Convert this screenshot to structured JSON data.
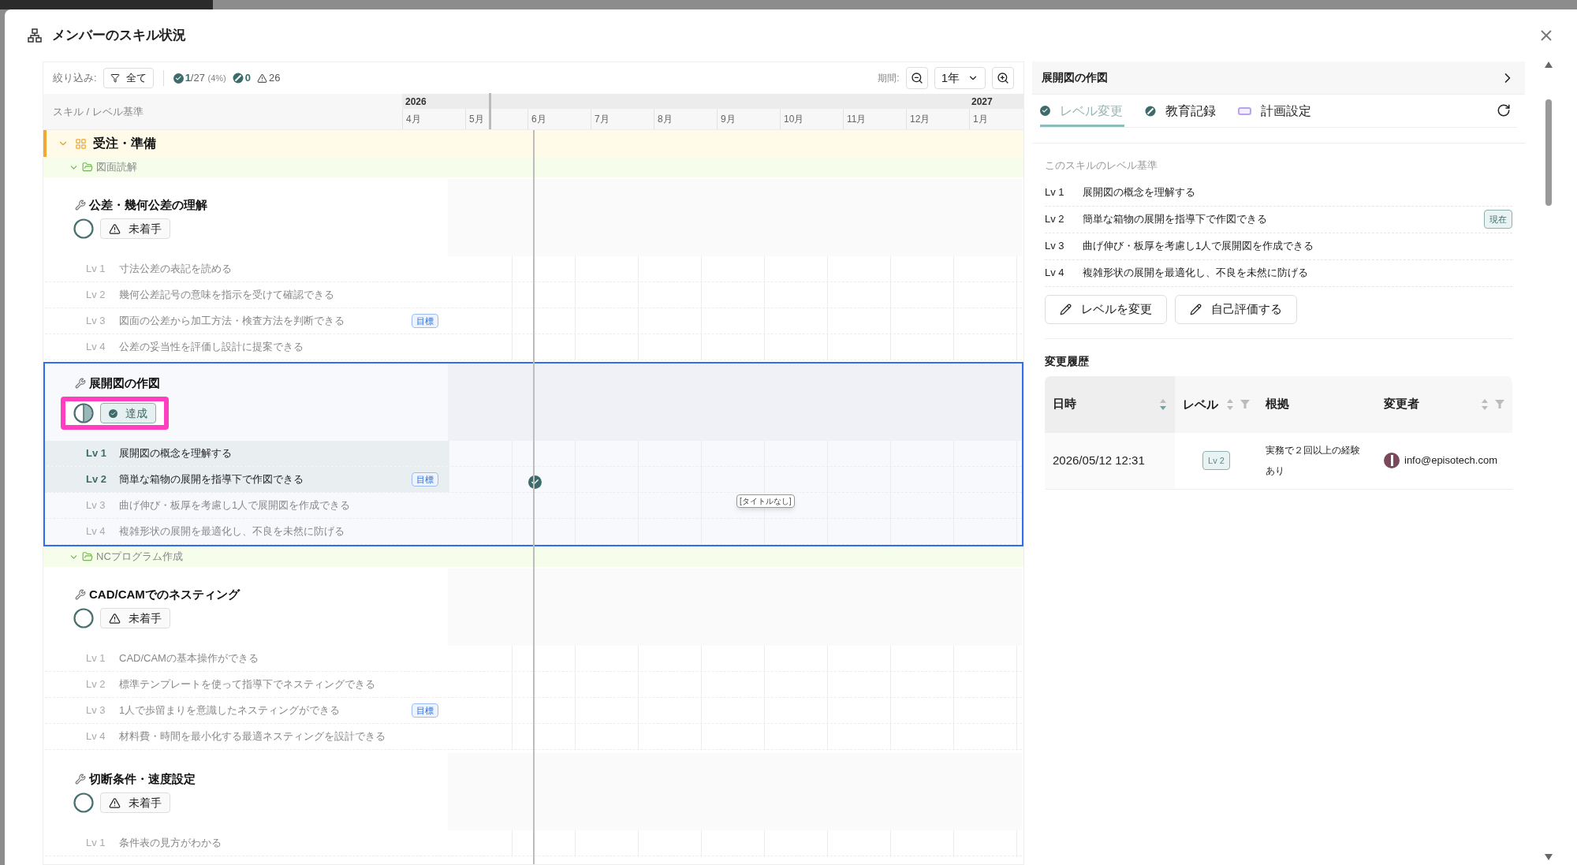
{
  "dialog": {
    "title": "メンバーのスキル状況"
  },
  "filter_bar": {
    "label": "絞り込み:",
    "filter_button": "全て",
    "achieved": "1",
    "achieved_total": "/27",
    "achieved_pct": "(4%)",
    "in_progress": "0",
    "not_started": "26",
    "period_label": "期間:",
    "period_value": "1年"
  },
  "timeline_header": {
    "column_label": "スキル / レベル基準",
    "years": [
      "2026",
      "2027"
    ],
    "months": [
      "4月",
      "5月",
      "6月",
      "7月",
      "8月",
      "9月",
      "10月",
      "11月",
      "12月",
      "1月"
    ]
  },
  "groups": [
    {
      "name": "受注・準備",
      "expanded": true,
      "categories": [
        {
          "name": "図面読解",
          "expanded": true,
          "skills": [
            {
              "name": "公差・幾何公差の理解",
              "kind": "not_started",
              "status_label": "未着手",
              "selected": false,
              "highlighted": false,
              "levels": [
                {
                  "label": "Lv 1",
                  "text": "寸法公差の表記を読める",
                  "achieved": false,
                  "marker": false
                },
                {
                  "label": "Lv 2",
                  "text": "幾何公差記号の意味を指示を受けて確認できる",
                  "achieved": false,
                  "marker": false
                },
                {
                  "label": "Lv 3",
                  "text": "図面の公差から加工方法・検査方法を判断できる",
                  "badge": "目標",
                  "achieved": false,
                  "marker": false
                },
                {
                  "label": "Lv 4",
                  "text": "公差の妥当性を評価し設計に提案できる",
                  "achieved": false,
                  "marker": false
                }
              ]
            },
            {
              "name": "展開図の作図",
              "kind": "achieved",
              "status_label": "達成",
              "selected": true,
              "highlighted": true,
              "levels": [
                {
                  "label": "Lv 1",
                  "text": "展開図の概念を理解する",
                  "achieved": true,
                  "marker": false
                },
                {
                  "label": "Lv 2",
                  "text": "簡単な箱物の展開を指導下で作図できる",
                  "badge": "目標",
                  "achieved": true,
                  "marker": true
                },
                {
                  "label": "Lv 3",
                  "text": "曲げ伸び・板厚を考慮し1人で展開図を作成できる",
                  "achieved": false,
                  "marker": false,
                  "tooltip": "[タイトルなし]"
                },
                {
                  "label": "Lv 4",
                  "text": "複雑形状の展開を最適化し、不良を未然に防げる",
                  "achieved": false,
                  "marker": false
                }
              ]
            }
          ]
        },
        {
          "name": "NCプログラム作成",
          "expanded": true,
          "skills": [
            {
              "name": "CAD/CAMでのネスティング",
              "kind": "not_started",
              "status_label": "未着手",
              "selected": false,
              "highlighted": false,
              "levels": [
                {
                  "label": "Lv 1",
                  "text": "CAD/CAMの基本操作ができる",
                  "achieved": false,
                  "marker": false
                },
                {
                  "label": "Lv 2",
                  "text": "標準テンプレートを使って指導下でネスティングできる",
                  "achieved": false,
                  "marker": false
                },
                {
                  "label": "Lv 3",
                  "text": "1人で歩留まりを意識したネスティングができる",
                  "badge": "目標",
                  "achieved": false,
                  "marker": false
                },
                {
                  "label": "Lv 4",
                  "text": "材料費・時間を最小化する最適ネスティングを設計できる",
                  "achieved": false,
                  "marker": false
                }
              ]
            },
            {
              "name": "切断条件・速度設定",
              "kind": "not_started",
              "status_label": "未着手",
              "selected": false,
              "highlighted": false,
              "levels": [
                {
                  "label": "Lv 1",
                  "text": "条件表の見方がわかる",
                  "achieved": false,
                  "marker": false
                }
              ]
            }
          ]
        }
      ]
    }
  ],
  "detail_panel": {
    "title": "展開図の作図",
    "tabs": [
      {
        "label": "レベル変更",
        "kind": "check",
        "selected": true
      },
      {
        "label": "教育記録",
        "kind": "slash",
        "selected": false
      },
      {
        "label": "計画設定",
        "kind": "plan",
        "selected": false
      }
    ],
    "criteria_title": "このスキルのレベル基準",
    "criteria": [
      {
        "label": "Lv 1",
        "text": "展開図の概念を理解する"
      },
      {
        "label": "Lv 2",
        "text": "簡単な箱物の展開を指導下で作図できる",
        "badge": "現在"
      },
      {
        "label": "Lv 3",
        "text": "曲げ伸び・板厚を考慮し1人で展開図を作成できる"
      },
      {
        "label": "Lv 4",
        "text": "複雑形状の展開を最適化し、不良を未然に防げる"
      }
    ],
    "buttons": [
      "レベルを変更",
      "自己評価する"
    ],
    "history_title": "変更履歴",
    "history_columns": [
      {
        "label": "日時",
        "sortable": true,
        "filterable": false,
        "sorted": true
      },
      {
        "label": "レベル",
        "sortable": true,
        "filterable": true,
        "sorted": false
      },
      {
        "label": "根拠",
        "sortable": false,
        "filterable": false
      },
      {
        "label": "変更者",
        "sortable": true,
        "filterable": true,
        "sorted": false
      }
    ],
    "history_rows": [
      {
        "date": "2026/05/12 12:31",
        "level": "Lv 2",
        "reason": "実務で２回以上の経験あり",
        "user": "info@episotech.com"
      }
    ]
  }
}
